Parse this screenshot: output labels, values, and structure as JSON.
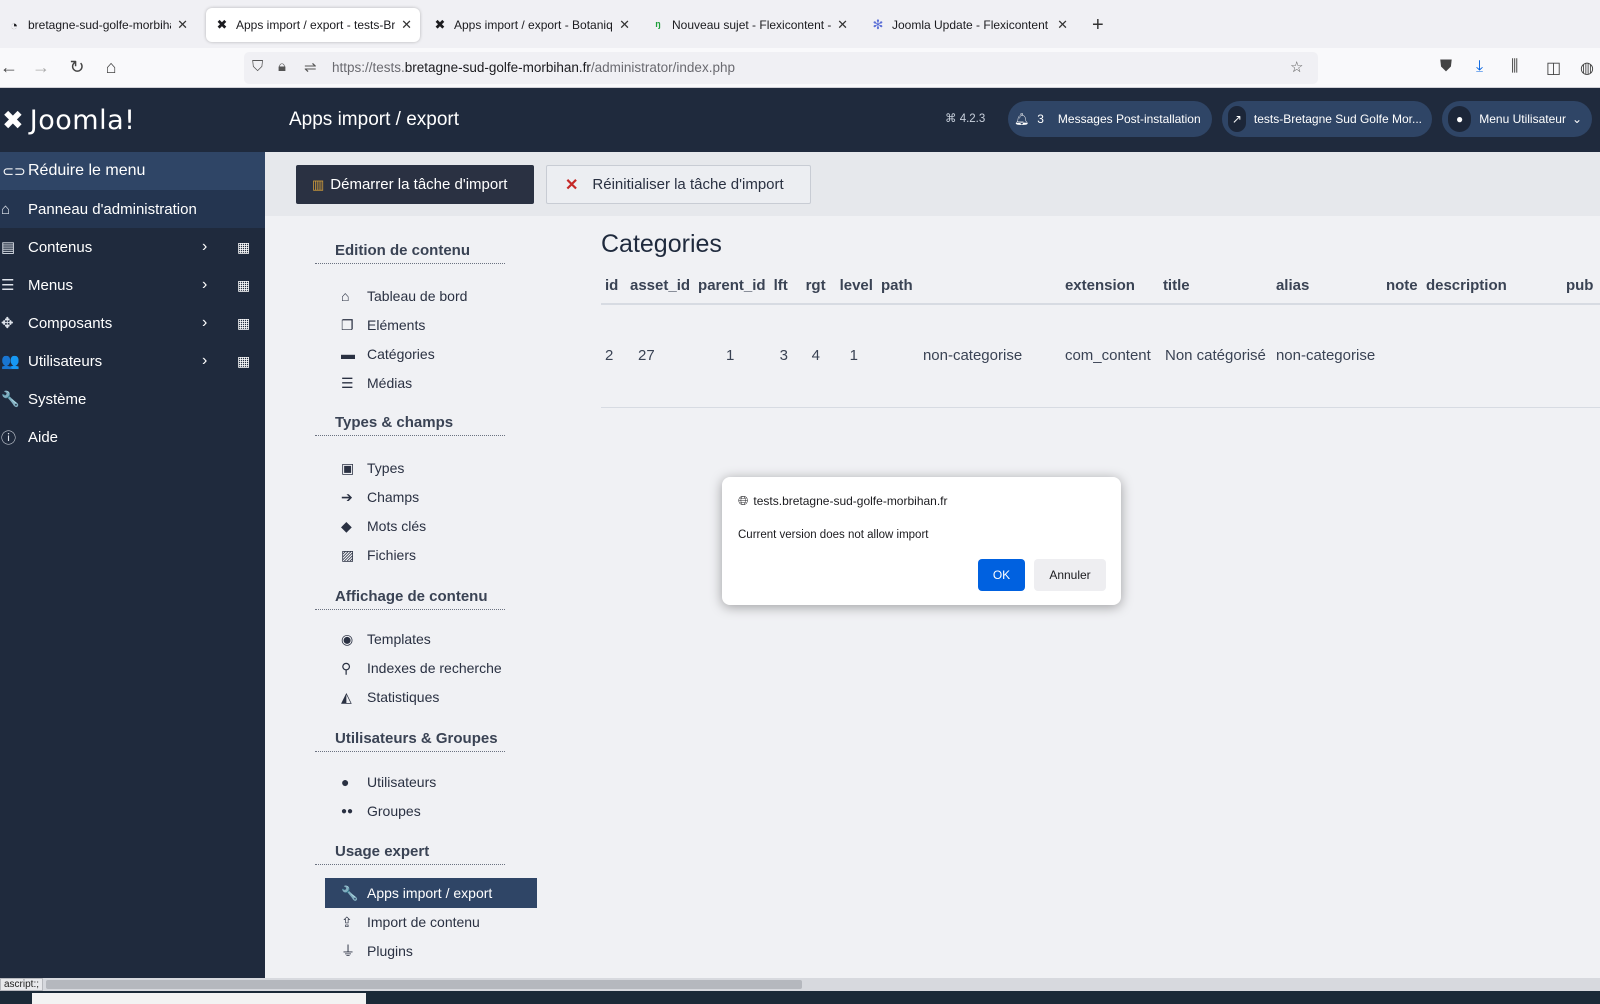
{
  "browser": {
    "tabs": [
      {
        "title": "bretagne-sud-golfe-morbihan.f",
        "icon": "globe-icon",
        "glyph": "◔"
      },
      {
        "title": "Apps import / export - tests-Bre",
        "icon": "joomla-icon",
        "glyph": "✖"
      },
      {
        "title": "Apps import / export - Botaniq",
        "icon": "joomla-icon",
        "glyph": "✖"
      },
      {
        "title": "Nouveau sujet - Flexicontent - F",
        "icon": "flexicontent-icon",
        "glyph": "ᵑ"
      },
      {
        "title": "Joomla Update - Flexicontent R",
        "icon": "joomla-gear-icon",
        "glyph": "✻"
      }
    ],
    "url_prefix": "https://tests.",
    "url_domain": "bretagne-sud-golfe-morbihan.fr",
    "url_path": "/administrator/index.php"
  },
  "sidebar": {
    "brand": "Joomla!",
    "collapse_label": "Réduire le menu",
    "items": [
      {
        "label": "Panneau d'administration",
        "icon": "home-icon",
        "glyph": "⌂"
      },
      {
        "label": "Contenus",
        "icon": "file-icon",
        "glyph": "▤"
      },
      {
        "label": "Menus",
        "icon": "list-icon",
        "glyph": "☰"
      },
      {
        "label": "Composants",
        "icon": "puzzle-icon",
        "glyph": "✥"
      },
      {
        "label": "Utilisateurs",
        "icon": "users-icon",
        "glyph": "👥"
      },
      {
        "label": "Système",
        "icon": "wrench-icon",
        "glyph": "🔧"
      },
      {
        "label": "Aide",
        "icon": "info-icon",
        "glyph": "ⓘ"
      }
    ]
  },
  "header": {
    "title": "Apps import / export",
    "version": "⌘ 4.2.3",
    "notifications_count": "3",
    "post_install": "Messages Post-installation",
    "site_link": "tests-Bretagne Sud Golfe Mor...",
    "user_menu": "Menu Utilisateur"
  },
  "toolbar": {
    "start_label": "Démarrer la tâche d'import",
    "reset_label": "Réinitialiser la tâche d'import"
  },
  "subnav": {
    "sections": [
      {
        "title": "Edition de contenu",
        "items": [
          {
            "label": "Tableau de bord",
            "icon": "home-icon",
            "glyph": "⌂"
          },
          {
            "label": "Eléments",
            "icon": "copy-icon",
            "glyph": "❐"
          },
          {
            "label": "Catégories",
            "icon": "folder-icon",
            "glyph": "▬"
          },
          {
            "label": "Médias",
            "icon": "sliders-icon",
            "glyph": "☰"
          }
        ]
      },
      {
        "title": "Types & champs",
        "items": [
          {
            "label": "Types",
            "icon": "briefcase-icon",
            "glyph": "▣"
          },
          {
            "label": "Champs",
            "icon": "sign-in-icon",
            "glyph": "➔"
          },
          {
            "label": "Mots clés",
            "icon": "tags-icon",
            "glyph": "◆"
          },
          {
            "label": "Fichiers",
            "icon": "image-icon",
            "glyph": "▨"
          }
        ]
      },
      {
        "title": "Affichage de contenu",
        "items": [
          {
            "label": "Templates",
            "icon": "eye-icon",
            "glyph": "◉"
          },
          {
            "label": "Indexes de recherche",
            "icon": "search-icon",
            "glyph": "⚲"
          },
          {
            "label": "Statistiques",
            "icon": "chart-icon",
            "glyph": "◭"
          }
        ]
      },
      {
        "title": "Utilisateurs & Groupes",
        "items": [
          {
            "label": "Utilisateurs",
            "icon": "user-icon",
            "glyph": "●"
          },
          {
            "label": "Groupes",
            "icon": "users-icon",
            "glyph": "●●"
          }
        ]
      },
      {
        "title": "Usage expert",
        "items": [
          {
            "label": "Apps import / export",
            "icon": "wrench-icon",
            "glyph": "🔧"
          },
          {
            "label": "Import de contenu",
            "icon": "upload-icon",
            "glyph": "⇪"
          },
          {
            "label": "Plugins",
            "icon": "plug-icon",
            "glyph": "⏚"
          }
        ]
      }
    ]
  },
  "panel": {
    "title": "Categories",
    "columns": [
      "id",
      "asset_id",
      "parent_id",
      "lft",
      "rgt",
      "level",
      "path",
      "extension",
      "title",
      "alias",
      "note",
      "description",
      "pub"
    ],
    "rows": [
      [
        "2",
        "27",
        "1",
        "3",
        "4",
        "1",
        "non-categorise",
        "com_content",
        "Non catégorisé",
        "non-categorise",
        "",
        "",
        ""
      ]
    ]
  },
  "dialog": {
    "origin": "tests.bretagne-sud-golfe-morbihan.fr",
    "message": "Current version does not allow import",
    "ok_label": "OK",
    "cancel_label": "Annuler"
  },
  "statusbar": {
    "text": "ascript:;"
  },
  "colors": {
    "sidebar_bg": "#1f2a3d",
    "active_item": "#2f4566",
    "primary_button": "#0061e0",
    "danger": "#c52827"
  }
}
